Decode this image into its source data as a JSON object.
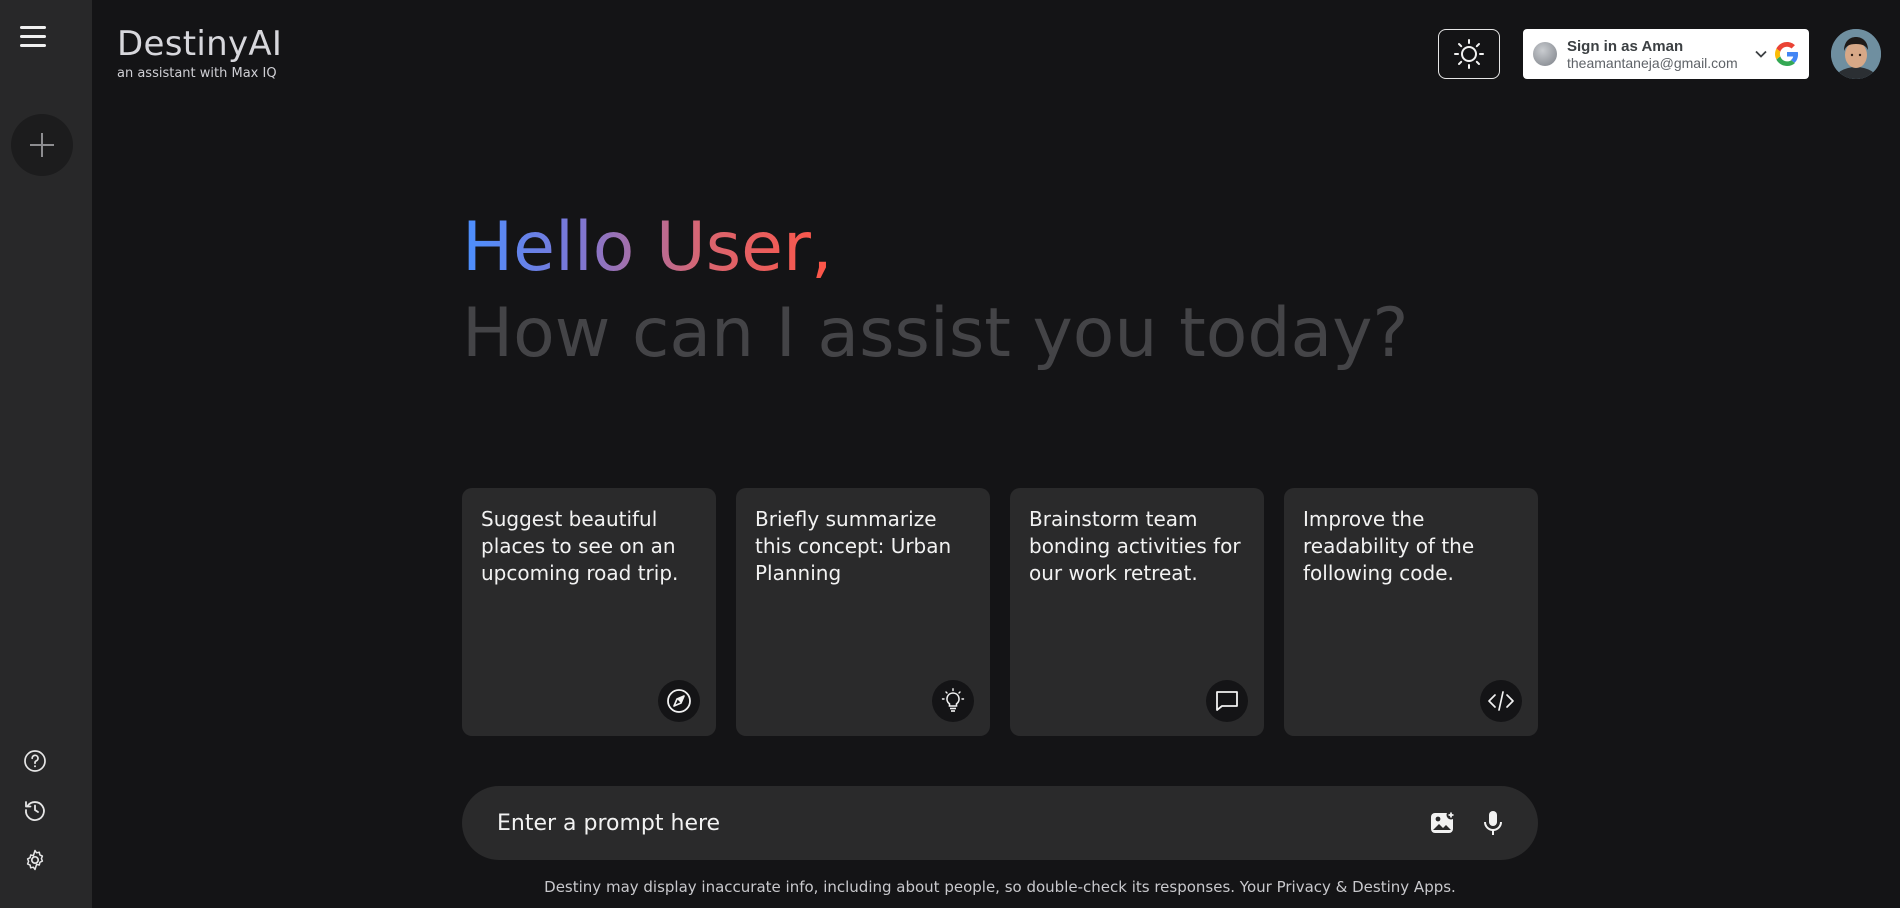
{
  "app": {
    "title": "DestinyAI",
    "subtitle": "an assistant with Max IQ"
  },
  "sidebar": {
    "menu_icon": "hamburger-icon",
    "new_chat_icon": "plus-icon",
    "bottom_icons": [
      "help-icon",
      "history-icon",
      "settings-icon"
    ]
  },
  "header": {
    "theme_icon": "sun-icon",
    "signin": {
      "name": "Sign in as Aman",
      "email": "theamantaneja@gmail.com"
    }
  },
  "greeting": {
    "hello": "Hello User,",
    "question": "How can I assist you today?"
  },
  "cards": [
    {
      "text": "Suggest beautiful places to see on an upcoming road trip.",
      "icon": "compass-icon"
    },
    {
      "text": "Briefly summarize this concept: Urban Planning",
      "icon": "bulb-icon"
    },
    {
      "text": "Brainstorm team bonding activities for our work retreat.",
      "icon": "message-icon"
    },
    {
      "text": "Improve the readability of the following code.",
      "icon": "code-icon"
    }
  ],
  "prompt": {
    "placeholder": "Enter a prompt here",
    "icons": [
      "gallery-icon",
      "mic-icon"
    ]
  },
  "footer": {
    "disclaimer": "Destiny may display inaccurate info, including about people, so double-check its responses. Your Privacy & Destiny Apps."
  },
  "colors": {
    "background": "#141416",
    "sidebar": "#282829",
    "card": "#2a2a2b",
    "gradient_start": "#4b90ff",
    "gradient_end": "#ff5546"
  }
}
